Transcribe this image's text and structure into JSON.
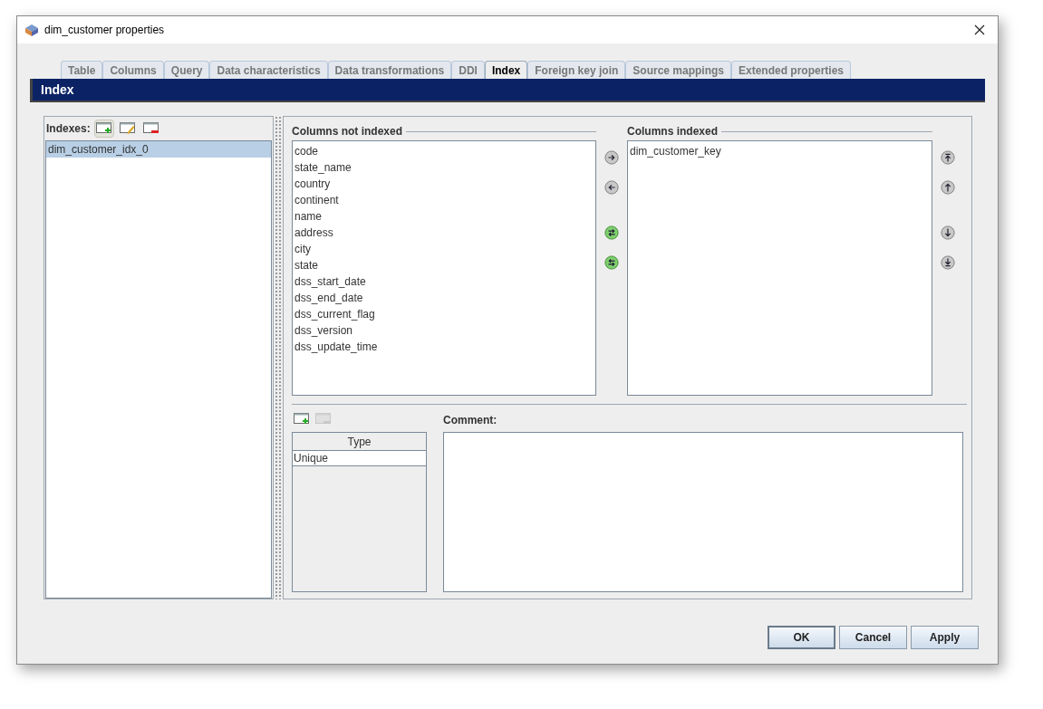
{
  "window": {
    "title": "dim_customer properties"
  },
  "tabs": [
    {
      "label": "Table",
      "selected": false
    },
    {
      "label": "Columns",
      "selected": false
    },
    {
      "label": "Query",
      "selected": false
    },
    {
      "label": "Data characteristics",
      "selected": false
    },
    {
      "label": "Data transformations",
      "selected": false
    },
    {
      "label": "DDI",
      "selected": false
    },
    {
      "label": "Index",
      "selected": true
    },
    {
      "label": "Foreign key join",
      "selected": false
    },
    {
      "label": "Source mappings",
      "selected": false
    },
    {
      "label": "Extended properties",
      "selected": false
    }
  ],
  "header": "Index",
  "indexes": {
    "label": "Indexes:",
    "tools": [
      {
        "kind": "add",
        "disabled": false
      },
      {
        "kind": "edit",
        "disabled": false
      },
      {
        "kind": "remove",
        "disabled": false
      }
    ],
    "items": [
      {
        "label": "dim_customer_idx_0",
        "selected": true
      }
    ]
  },
  "not_indexed": {
    "title": "Columns not indexed",
    "items": [
      "code",
      "state_name",
      "country",
      "continent",
      "name",
      "address",
      "city",
      "state",
      "dss_start_date",
      "dss_end_date",
      "dss_current_flag",
      "dss_version",
      "dss_update_time"
    ]
  },
  "move_buttons": [
    {
      "kind": "right"
    },
    {
      "kind": "left"
    },
    {
      "kind": "all-right"
    },
    {
      "kind": "all-left"
    }
  ],
  "indexed": {
    "title": "Columns indexed",
    "items": [
      "dim_customer_key"
    ]
  },
  "order_buttons": [
    {
      "kind": "top"
    },
    {
      "kind": "up"
    },
    {
      "kind": "down"
    },
    {
      "kind": "bottom"
    }
  ],
  "type_tools": [
    {
      "kind": "add",
      "disabled": false
    },
    {
      "kind": "remove",
      "disabled": true
    }
  ],
  "type_table": {
    "header": "Type",
    "rows": [
      "Unique"
    ]
  },
  "comment": {
    "label": "Comment:"
  },
  "buttons": [
    {
      "label": "OK",
      "default": true
    },
    {
      "label": "Cancel",
      "default": false
    },
    {
      "label": "Apply",
      "default": false
    }
  ]
}
